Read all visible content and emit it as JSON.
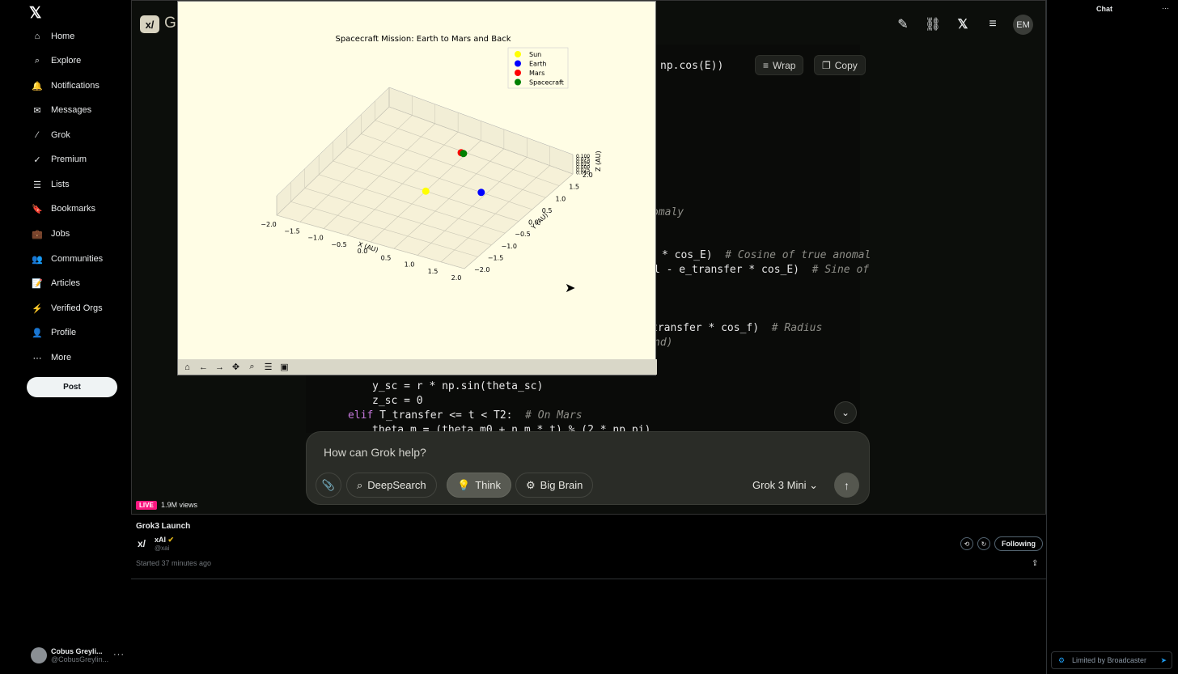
{
  "nav": {
    "items": [
      {
        "label": "Home",
        "icon": "home-icon"
      },
      {
        "label": "Explore",
        "icon": "search-icon"
      },
      {
        "label": "Notifications",
        "icon": "bell-icon"
      },
      {
        "label": "Messages",
        "icon": "envelope-icon"
      },
      {
        "label": "Grok",
        "icon": "grok-icon"
      },
      {
        "label": "Premium",
        "icon": "verified-icon"
      },
      {
        "label": "Lists",
        "icon": "list-icon"
      },
      {
        "label": "Bookmarks",
        "icon": "bookmark-icon"
      },
      {
        "label": "Jobs",
        "icon": "briefcase-icon"
      },
      {
        "label": "Communities",
        "icon": "people-icon"
      },
      {
        "label": "Articles",
        "icon": "article-icon"
      },
      {
        "label": "Verified Orgs",
        "icon": "lightning-icon"
      },
      {
        "label": "Profile",
        "icon": "person-icon"
      },
      {
        "label": "More",
        "icon": "more-circle-icon"
      }
    ],
    "post_label": "Post",
    "user_name": "Cobus Greyli...",
    "user_handle": "@CobusGreylin..."
  },
  "stage": {
    "app_letter": "G",
    "avatar_initials": "EM",
    "wrap_label": "Wrap",
    "copy_label": "Copy",
    "code_lines": [
      {
        "text": "np.cos(E))"
      },
      {
        "text": "omaly"
      },
      {
        "text": "* cos_E)  "
      },
      {
        "text": "# Cosine of true anomal"
      },
      {
        "text": "l - e_transfer * cos_E)  "
      },
      {
        "text": "# Sine of"
      },
      {
        "text": "transfer * cos_f)  "
      },
      {
        "text": "# Radius"
      },
      {
        "text": "nd)"
      },
      {
        "text": "y_sc = r * np.sin(theta_sc)"
      },
      {
        "text": "z_sc = 0"
      },
      {
        "text": "elif"
      },
      {
        "text": " T_transfer <= t < T2:  "
      },
      {
        "text": "# On Mars"
      },
      {
        "text": "theta_m = (theta_m0 + n_m * t) % (2 * np.pi)"
      }
    ]
  },
  "composer": {
    "placeholder": "How can Grok help?",
    "deepsearch_label": "DeepSearch",
    "think_label": "Think",
    "bigbrain_label": "Big Brain",
    "model_label": "Grok 3 Mini"
  },
  "broadcast": {
    "live_label": "LIVE",
    "views": "1.9M views",
    "title": "Grok3 Launch",
    "host_name": "xAI",
    "host_handle": "@xai",
    "started": "Started 37 minutes ago",
    "following_label": "Following"
  },
  "sidebar_right": {
    "chat_label": "Chat",
    "limited_label": "Limited by Broadcaster"
  },
  "chart_data": {
    "type": "scatter",
    "title": "Spacecraft Mission: Earth to Mars and Back",
    "xlabel": "X (AU)",
    "ylabel": "Y (AU)",
    "zlabel": "Z (AU)",
    "xlim": [
      -2.0,
      2.0
    ],
    "ylim": [
      -2.0,
      2.0
    ],
    "x_ticks": [
      "−2.0",
      "−1.5",
      "−1.0",
      "−0.5",
      "0.0",
      "0.5",
      "1.0",
      "1.5",
      "2.0"
    ],
    "y_ticks": [
      "−2.0",
      "−1.5",
      "−1.0",
      "−0.5",
      "0.0",
      "0.5",
      "1.0",
      "1.5",
      "2.0"
    ],
    "z_ticks": [
      "0.100",
      "0.075",
      "0.050",
      "0.025",
      "0.000",
      "0.025",
      "0.050"
    ],
    "legend_position": "top-right",
    "series": [
      {
        "name": "Sun",
        "color": "#ffff00",
        "points": [
          {
            "x": 0.0,
            "y": 0.0,
            "z": 0.0
          }
        ]
      },
      {
        "name": "Earth",
        "color": "#0000ff",
        "points": [
          {
            "x": 0.9,
            "y": 0.5,
            "z": 0.0
          }
        ]
      },
      {
        "name": "Mars",
        "color": "#ff0000",
        "points": [
          {
            "x": -0.1,
            "y": 1.45,
            "z": 0.0
          }
        ]
      },
      {
        "name": "Spacecraft",
        "color": "#008000",
        "points": [
          {
            "x": -0.05,
            "y": 1.45,
            "z": 0.0
          }
        ]
      }
    ]
  }
}
